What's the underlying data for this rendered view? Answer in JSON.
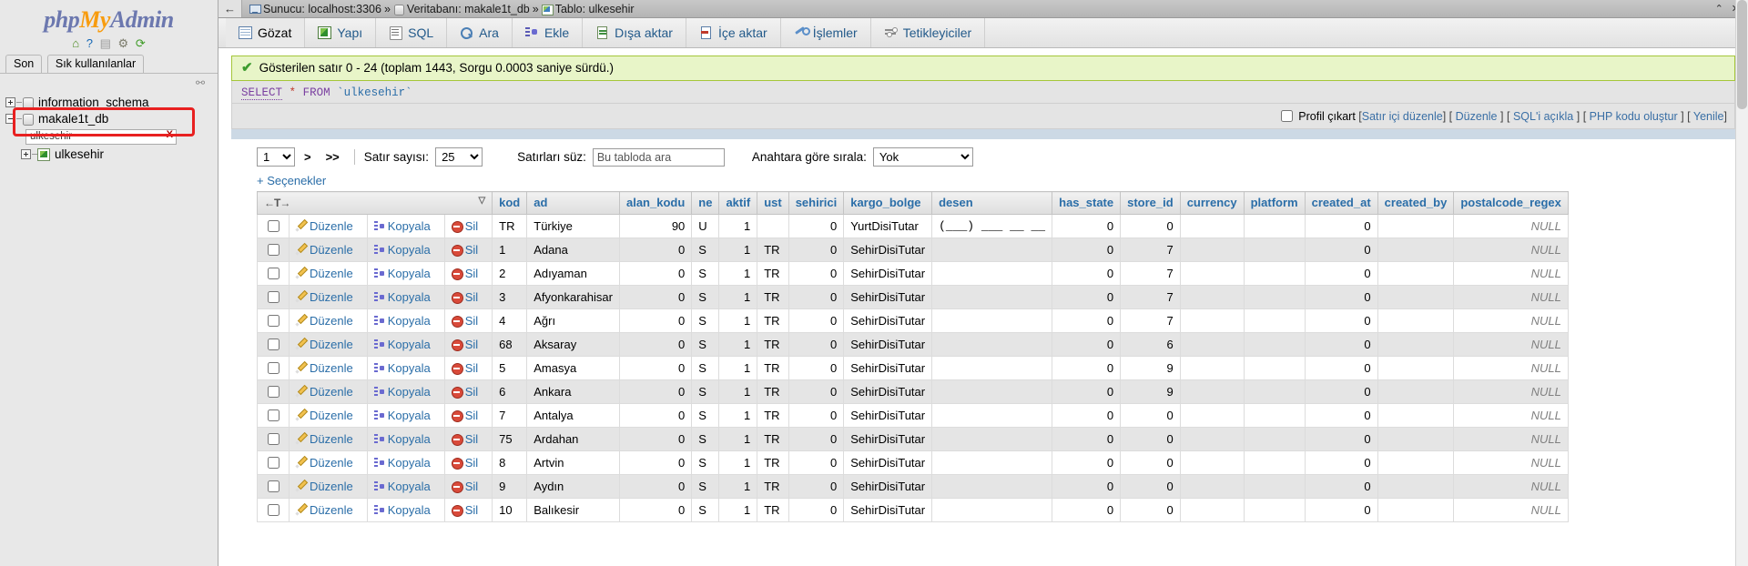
{
  "sidebar": {
    "logo": {
      "php": "php",
      "my": "My",
      "admin": "Admin"
    },
    "icons": [
      {
        "name": "home-icon",
        "glyph": "⌂"
      },
      {
        "name": "help-icon",
        "glyph": "?"
      },
      {
        "name": "docs-icon",
        "glyph": "▤"
      },
      {
        "name": "settings-gear-icon",
        "glyph": "⚙"
      },
      {
        "name": "refresh-icon",
        "glyph": "⟳"
      }
    ],
    "tabs": [
      {
        "label": "Son"
      },
      {
        "label": "Sık kullanılanlar"
      }
    ],
    "chain_icon": "⚯",
    "tree": [
      {
        "label": "information_schema",
        "expanded": false,
        "type": "database"
      },
      {
        "label": "makale1t_db",
        "expanded": true,
        "type": "database"
      }
    ],
    "table_filter": {
      "value": "ulkesehir",
      "clear": "X"
    },
    "table_node": {
      "label": "ulkesehir",
      "type": "table"
    }
  },
  "topbar": {
    "back": "←",
    "breadcrumb": {
      "server_label": "Sunucu: localhost:3306",
      "sep1": "»",
      "database_label": "Veritabanı: makale1t_db",
      "sep2": "»",
      "table_label": "Tablo: ulkesehir"
    },
    "window_controls": [
      "⌃",
      "✕"
    ]
  },
  "tabs": [
    {
      "label": "Gözat",
      "icon": "browse-icon",
      "active": true
    },
    {
      "label": "Yapı",
      "icon": "structure-icon",
      "active": false
    },
    {
      "label": "SQL",
      "icon": "sql-icon",
      "active": false
    },
    {
      "label": "Ara",
      "icon": "search-icon",
      "active": false
    },
    {
      "label": "Ekle",
      "icon": "insert-icon",
      "active": false
    },
    {
      "label": "Dışa aktar",
      "icon": "export-icon",
      "active": false
    },
    {
      "label": "İçe aktar",
      "icon": "import-icon",
      "active": false
    },
    {
      "label": "İşlemler",
      "icon": "operations-icon",
      "active": false
    },
    {
      "label": "Tetikleyiciler",
      "icon": "triggers-icon",
      "active": false
    }
  ],
  "status": {
    "check": "✔",
    "message": "Gösterilen satır 0 - 24 (toplam 1443, Sorgu 0.0003 saniye sürdü.)"
  },
  "sql": {
    "keyword": "SELECT",
    "star": "*",
    "from": "FROM",
    "table": "`ulkesehir`"
  },
  "sql_links": {
    "profile_label": "Profil çıkart",
    "items": [
      {
        "label": "Satır içi düzenle",
        "open": "[",
        "close": "]"
      },
      {
        "label": "Düzenle",
        "open": "[",
        "close": "]"
      },
      {
        "label": "SQL'i açıkla",
        "open": "[",
        "close": "]"
      },
      {
        "label": "PHP kodu oluştur",
        "open": "[",
        "close": "]"
      },
      {
        "label": "Yenile",
        "open": "[",
        "close": "]"
      }
    ]
  },
  "controls": {
    "page_value": "1",
    "next": ">",
    "last": ">>",
    "rows_label": "Satır sayısı:",
    "rows_value": "25",
    "filter_label": "Satırları süz:",
    "filter_placeholder": "Bu tabloda ara",
    "sort_label": "Anahtara göre sırala:",
    "sort_value": "Yok",
    "options_link": "+ Seçenekler"
  },
  "table": {
    "actions": {
      "edit": "Düzenle",
      "copy": "Kopyala",
      "delete": "Sil"
    },
    "columns": [
      "kod",
      "ad",
      "alan_kodu",
      "ne",
      "aktif",
      "ust",
      "sehirici",
      "kargo_bolge",
      "desen",
      "has_state",
      "store_id",
      "currency",
      "platform",
      "created_at",
      "created_by",
      "postalcode_regex"
    ],
    "rows": [
      {
        "kod": "TR",
        "ad": "Türkiye",
        "alan_kodu": "90",
        "ne": "U",
        "aktif": "1",
        "ust": "",
        "sehirici": "0",
        "kargo_bolge": "YurtDisiTutar",
        "desen": "(___) ___ __ __",
        "has_state": "0",
        "store_id": "0",
        "currency": "",
        "platform": "",
        "created_at": "0",
        "created_by": "",
        "postalcode_regex": "NULL"
      },
      {
        "kod": "1",
        "ad": "Adana",
        "alan_kodu": "0",
        "ne": "S",
        "aktif": "1",
        "ust": "TR",
        "sehirici": "0",
        "kargo_bolge": "SehirDisiTutar",
        "desen": "",
        "has_state": "0",
        "store_id": "7",
        "currency": "",
        "platform": "",
        "created_at": "0",
        "created_by": "",
        "postalcode_regex": "NULL"
      },
      {
        "kod": "2",
        "ad": "Adıyaman",
        "alan_kodu": "0",
        "ne": "S",
        "aktif": "1",
        "ust": "TR",
        "sehirici": "0",
        "kargo_bolge": "SehirDisiTutar",
        "desen": "",
        "has_state": "0",
        "store_id": "7",
        "currency": "",
        "platform": "",
        "created_at": "0",
        "created_by": "",
        "postalcode_regex": "NULL"
      },
      {
        "kod": "3",
        "ad": "Afyonkarahisar",
        "alan_kodu": "0",
        "ne": "S",
        "aktif": "1",
        "ust": "TR",
        "sehirici": "0",
        "kargo_bolge": "SehirDisiTutar",
        "desen": "",
        "has_state": "0",
        "store_id": "7",
        "currency": "",
        "platform": "",
        "created_at": "0",
        "created_by": "",
        "postalcode_regex": "NULL"
      },
      {
        "kod": "4",
        "ad": "Ağrı",
        "alan_kodu": "0",
        "ne": "S",
        "aktif": "1",
        "ust": "TR",
        "sehirici": "0",
        "kargo_bolge": "SehirDisiTutar",
        "desen": "",
        "has_state": "0",
        "store_id": "7",
        "currency": "",
        "platform": "",
        "created_at": "0",
        "created_by": "",
        "postalcode_regex": "NULL"
      },
      {
        "kod": "68",
        "ad": "Aksaray",
        "alan_kodu": "0",
        "ne": "S",
        "aktif": "1",
        "ust": "TR",
        "sehirici": "0",
        "kargo_bolge": "SehirDisiTutar",
        "desen": "",
        "has_state": "0",
        "store_id": "6",
        "currency": "",
        "platform": "",
        "created_at": "0",
        "created_by": "",
        "postalcode_regex": "NULL"
      },
      {
        "kod": "5",
        "ad": "Amasya",
        "alan_kodu": "0",
        "ne": "S",
        "aktif": "1",
        "ust": "TR",
        "sehirici": "0",
        "kargo_bolge": "SehirDisiTutar",
        "desen": "",
        "has_state": "0",
        "store_id": "9",
        "currency": "",
        "platform": "",
        "created_at": "0",
        "created_by": "",
        "postalcode_regex": "NULL"
      },
      {
        "kod": "6",
        "ad": "Ankara",
        "alan_kodu": "0",
        "ne": "S",
        "aktif": "1",
        "ust": "TR",
        "sehirici": "0",
        "kargo_bolge": "SehirDisiTutar",
        "desen": "",
        "has_state": "0",
        "store_id": "9",
        "currency": "",
        "platform": "",
        "created_at": "0",
        "created_by": "",
        "postalcode_regex": "NULL"
      },
      {
        "kod": "7",
        "ad": "Antalya",
        "alan_kodu": "0",
        "ne": "S",
        "aktif": "1",
        "ust": "TR",
        "sehirici": "0",
        "kargo_bolge": "SehirDisiTutar",
        "desen": "",
        "has_state": "0",
        "store_id": "0",
        "currency": "",
        "platform": "",
        "created_at": "0",
        "created_by": "",
        "postalcode_regex": "NULL"
      },
      {
        "kod": "75",
        "ad": "Ardahan",
        "alan_kodu": "0",
        "ne": "S",
        "aktif": "1",
        "ust": "TR",
        "sehirici": "0",
        "kargo_bolge": "SehirDisiTutar",
        "desen": "",
        "has_state": "0",
        "store_id": "0",
        "currency": "",
        "platform": "",
        "created_at": "0",
        "created_by": "",
        "postalcode_regex": "NULL"
      },
      {
        "kod": "8",
        "ad": "Artvin",
        "alan_kodu": "0",
        "ne": "S",
        "aktif": "1",
        "ust": "TR",
        "sehirici": "0",
        "kargo_bolge": "SehirDisiTutar",
        "desen": "",
        "has_state": "0",
        "store_id": "0",
        "currency": "",
        "platform": "",
        "created_at": "0",
        "created_by": "",
        "postalcode_regex": "NULL"
      },
      {
        "kod": "9",
        "ad": "Aydın",
        "alan_kodu": "0",
        "ne": "S",
        "aktif": "1",
        "ust": "TR",
        "sehirici": "0",
        "kargo_bolge": "SehirDisiTutar",
        "desen": "",
        "has_state": "0",
        "store_id": "0",
        "currency": "",
        "platform": "",
        "created_at": "0",
        "created_by": "",
        "postalcode_regex": "NULL"
      },
      {
        "kod": "10",
        "ad": "Balıkesir",
        "alan_kodu": "0",
        "ne": "S",
        "aktif": "1",
        "ust": "TR",
        "sehirici": "0",
        "kargo_bolge": "SehirDisiTutar",
        "desen": "",
        "has_state": "0",
        "store_id": "0",
        "currency": "",
        "platform": "",
        "created_at": "0",
        "created_by": "",
        "postalcode_regex": "NULL"
      }
    ]
  },
  "colors": {
    "accent": "#2b6ea8",
    "success_bg": "#e8f5c8",
    "success_border": "#a5c63a",
    "highlight": "#e82020",
    "logo_blue": "#6c78af",
    "logo_orange": "#f89c0e"
  }
}
